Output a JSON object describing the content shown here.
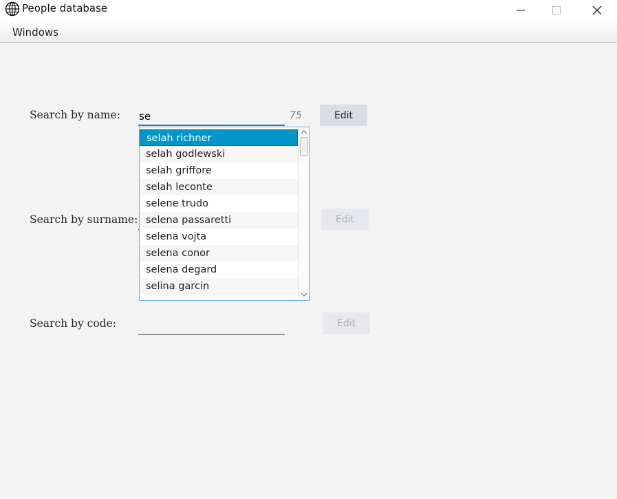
{
  "window": {
    "title": "People database",
    "icon": "globe-icon"
  },
  "menu": {
    "windows": "Windows"
  },
  "search": {
    "name": {
      "label": "Search by name:",
      "value": "se",
      "count": "75",
      "button": "Edit"
    },
    "surname": {
      "label": "Search by surname:",
      "value": "",
      "button": "Edit"
    },
    "code": {
      "label": "Search by code:",
      "value": "",
      "button": "Edit"
    }
  },
  "suggestions": {
    "items": [
      "selah richner",
      "selah godlewski",
      "selah griffore",
      "selah leconte",
      "selene trudo",
      "selena passaretti",
      "selena vojta",
      "selena conor",
      "selena degard",
      "selina garcin"
    ],
    "selected_index": 0
  },
  "colors": {
    "accent": "#0096c9",
    "button": "#d8dde6"
  }
}
